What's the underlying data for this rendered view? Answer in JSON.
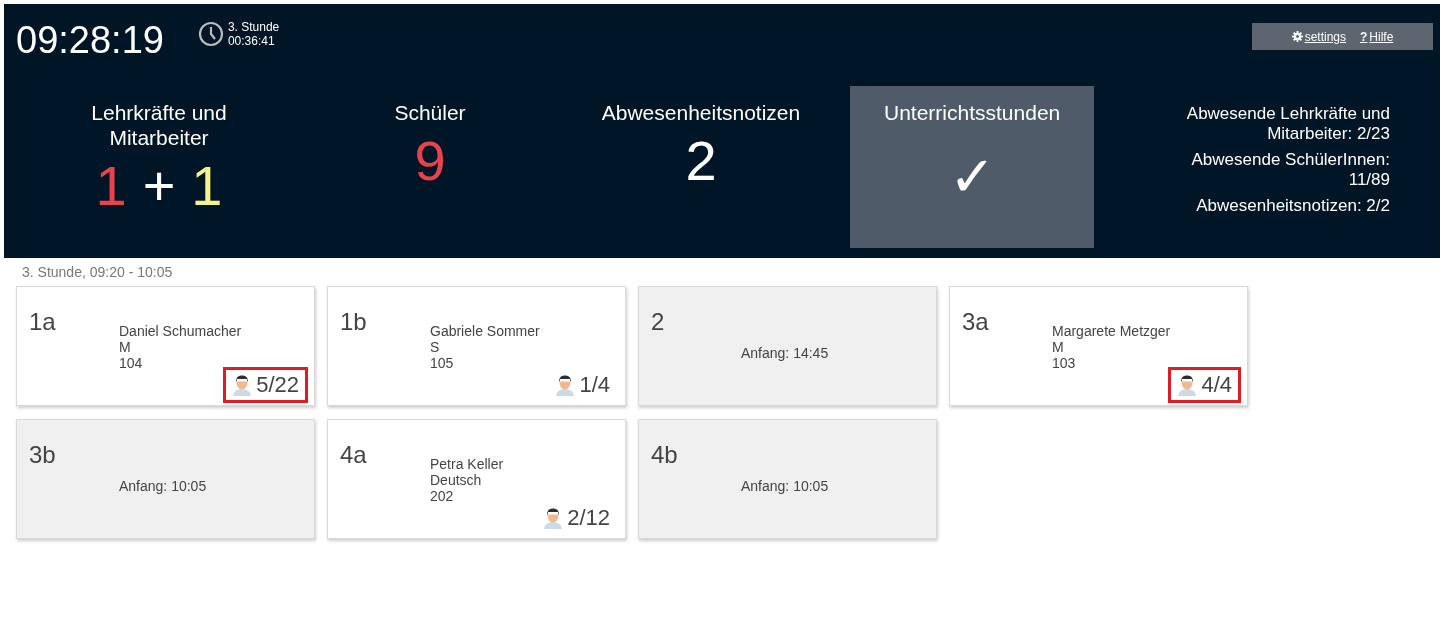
{
  "header": {
    "time": "09:28:19",
    "period": {
      "name": "3. Stunde",
      "remaining": "00:36:41"
    },
    "links": [
      {
        "kind": "settings",
        "label": "settings"
      },
      {
        "kind": "help",
        "glyph": "?",
        "label": "Hilfe"
      }
    ],
    "stats": [
      {
        "title": "Lehrkräfte und Mitarbeiter",
        "selected": false,
        "parts": [
          {
            "text": "1",
            "color": "#e8434d"
          },
          {
            "text": "+",
            "color": "#ffffff"
          },
          {
            "text": "1",
            "color": "#f6f38a"
          }
        ]
      },
      {
        "title": "Schüler",
        "selected": false,
        "parts": [
          {
            "text": "9",
            "color": "#e8434d"
          }
        ]
      },
      {
        "title": "Abwesenheitsnotizen",
        "selected": false,
        "parts": [
          {
            "text": "2",
            "color": "#ffffff"
          }
        ]
      },
      {
        "title": "Unterrichtsstunden",
        "selected": true,
        "parts": [
          {
            "text": "✓",
            "color": "#ffffff"
          }
        ]
      }
    ],
    "summary": [
      "Abwesende Lehrkräfte und Mitarbeiter: 2/23",
      "Abwesende SchülerInnen: 11/89",
      "Abwesenheitsnotizen: 2/2"
    ]
  },
  "section_title": "3. Stunde, 09:20 - 10:05",
  "classes": [
    {
      "kind": "lesson",
      "name": "1a",
      "teacher": "Daniel Schumacher",
      "subject": "M",
      "room": "104",
      "count": "5/22",
      "alert": true
    },
    {
      "kind": "lesson",
      "name": "1b",
      "teacher": "Gabriele Sommer",
      "subject": "S",
      "room": "105",
      "count": "1/4",
      "alert": false
    },
    {
      "kind": "pending",
      "name": "2",
      "start": "Anfang: 14:45"
    },
    {
      "kind": "lesson",
      "name": "3a",
      "teacher": "Margarete Metzger",
      "subject": "M",
      "room": "103",
      "count": "4/4",
      "alert": true
    },
    {
      "kind": "pending",
      "name": "3b",
      "start": "Anfang: 10:05"
    },
    {
      "kind": "lesson",
      "name": "4a",
      "teacher": "Petra Keller",
      "subject": "Deutsch",
      "room": "202",
      "count": "2/12",
      "alert": false
    },
    {
      "kind": "pending",
      "name": "4b",
      "start": "Anfang: 10:05"
    }
  ]
}
